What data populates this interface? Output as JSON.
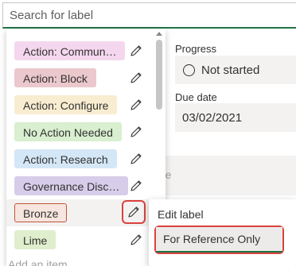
{
  "search": {
    "placeholder": "Search for label"
  },
  "details": {
    "progress_label": "Progress",
    "progress_value": "Not started",
    "due_date_label": "Due date",
    "due_date_value": "03/02/2021",
    "partial_text": "re"
  },
  "labels": [
    {
      "text": "Action: Commun…",
      "bg": "#f4d7ef",
      "border": "#f4d7ef"
    },
    {
      "text": "Action: Block",
      "bg": "#ebc8cc",
      "border": "#ebc8cc"
    },
    {
      "text": "Action: Configure",
      "bg": "#f8edd1",
      "border": "#f8edd1"
    },
    {
      "text": "No Action Needed",
      "bg": "#d8efd0",
      "border": "#d8efd0"
    },
    {
      "text": "Action: Research",
      "bg": "#d4e7f7",
      "border": "#d4e7f7"
    },
    {
      "text": "Governance Disc…",
      "bg": "#d7cdea",
      "border": "#d7cdea"
    },
    {
      "text": "Bronze",
      "bg": "#f6e6df",
      "border": "#c4553a"
    },
    {
      "text": "Lime",
      "bg": "#dfeecd",
      "border": "#dfeecd"
    }
  ],
  "add_item": "Add an item",
  "context_menu": {
    "edit_label": "Edit label",
    "selected_item": "For Reference Only"
  },
  "colors": {
    "accent": "#217346",
    "highlight_box": "#d9423e"
  }
}
